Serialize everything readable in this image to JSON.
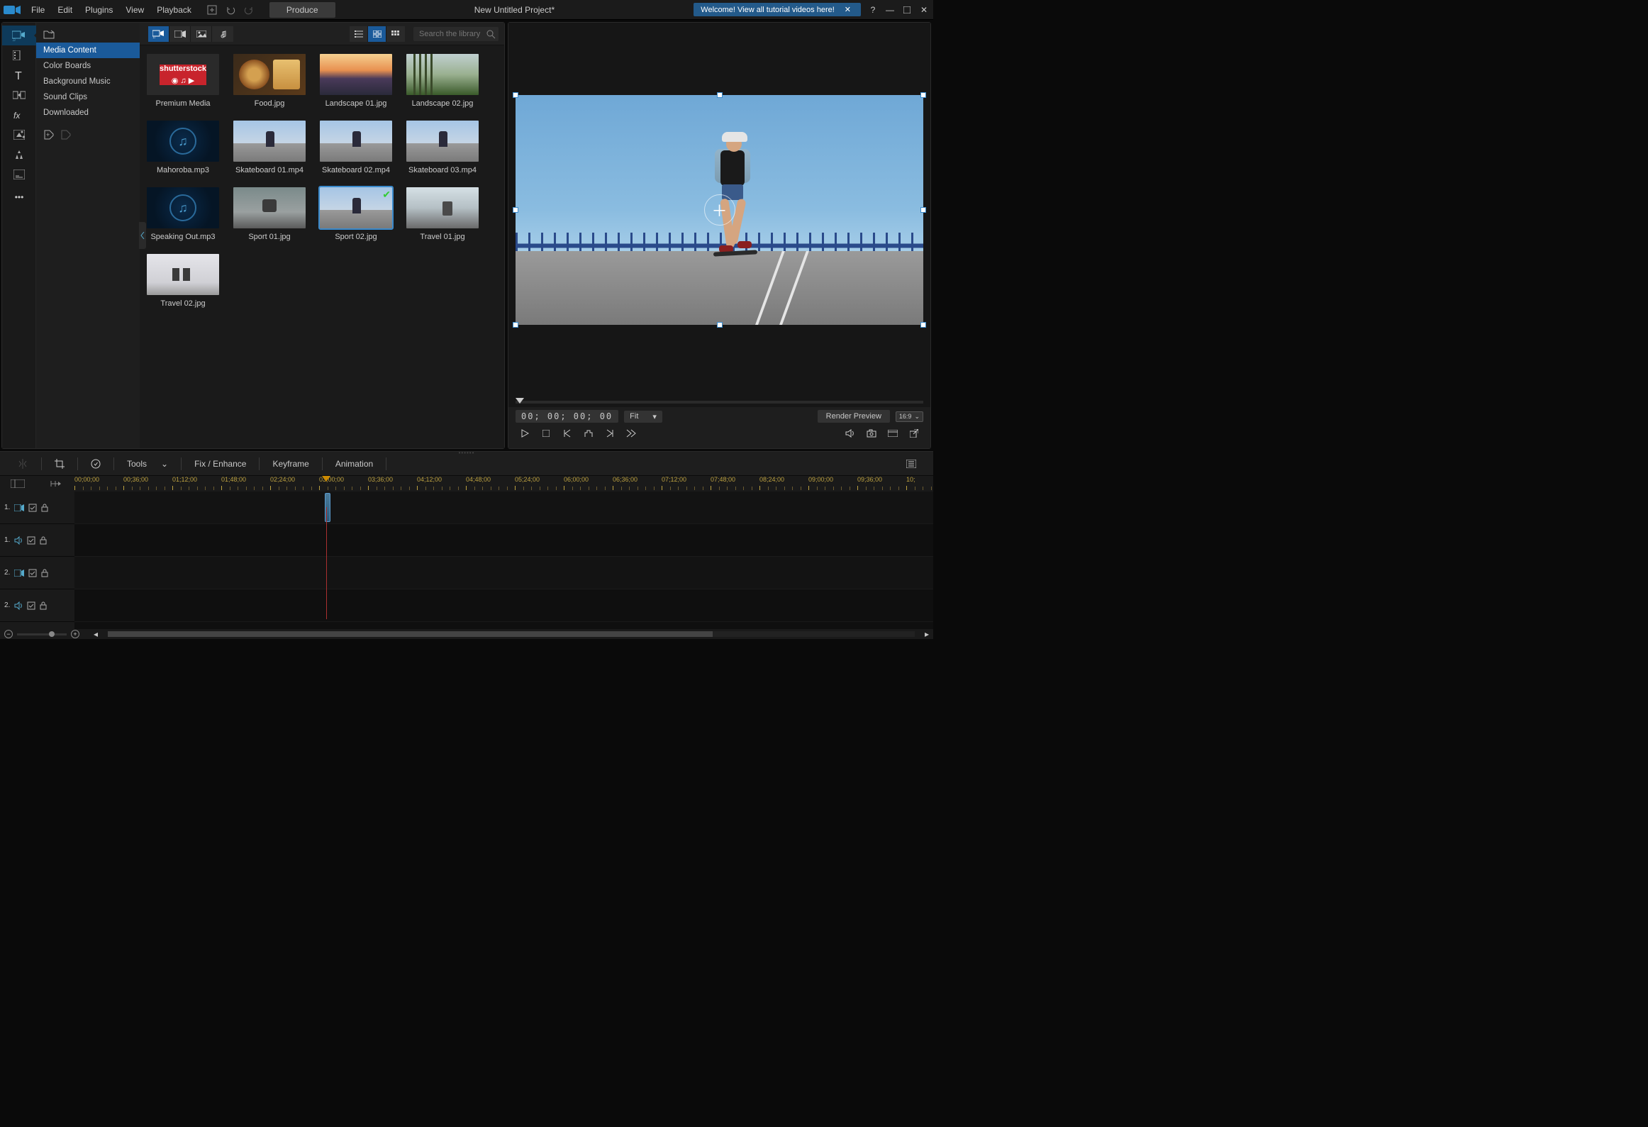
{
  "title_bar": {
    "menus": [
      "File",
      "Edit",
      "Plugins",
      "View",
      "Playback"
    ],
    "produce_label": "Produce",
    "project_title": "New Untitled Project*",
    "welcome_text": "Welcome! View all tutorial videos here!",
    "welcome_close": "✕"
  },
  "sidebar": {
    "items": [
      "Media Content",
      "Color Boards",
      "Background Music",
      "Sound Clips",
      "Downloaded"
    ],
    "selected_index": 0
  },
  "library": {
    "search_placeholder": "Search the library",
    "items": [
      {
        "label": "Premium Media",
        "kind": "shutterstock"
      },
      {
        "label": "Food.jpg",
        "kind": "food"
      },
      {
        "label": "Landscape 01.jpg",
        "kind": "land1"
      },
      {
        "label": "Landscape 02.jpg",
        "kind": "land2"
      },
      {
        "label": "Mahoroba.mp3",
        "kind": "audio"
      },
      {
        "label": "Skateboard 01.mp4",
        "kind": "skate"
      },
      {
        "label": "Skateboard 02.mp4",
        "kind": "skate"
      },
      {
        "label": "Skateboard 03.mp4",
        "kind": "skate"
      },
      {
        "label": "Speaking Out.mp3",
        "kind": "audio"
      },
      {
        "label": "Sport 01.jpg",
        "kind": "sport1"
      },
      {
        "label": "Sport 02.jpg",
        "kind": "skate",
        "selected": true,
        "checked": true
      },
      {
        "label": "Travel 01.jpg",
        "kind": "travel1"
      },
      {
        "label": "Travel 02.jpg",
        "kind": "travel2"
      }
    ]
  },
  "preview": {
    "timecode": "00; 00; 00; 00",
    "fit_label": "Fit",
    "render_label": "Render Preview",
    "aspect": "16:9"
  },
  "timeline": {
    "toolbar": {
      "tools": "Tools",
      "fix": "Fix / Enhance",
      "keyframe": "Keyframe",
      "animation": "Animation"
    },
    "ruler_ticks": [
      "00;00;00",
      "00;36;00",
      "01;12;00",
      "01;48;00",
      "02;24;00",
      "03;00;00",
      "03;36;00",
      "04;12;00",
      "04;48;00",
      "05;24;00",
      "06;00;00",
      "06;36;00",
      "07;12;00",
      "07;48;00",
      "08;24;00",
      "09;00;00",
      "09;36;00",
      "10;"
    ],
    "playhead_tick_index": 5,
    "tracks": [
      {
        "num": "1.",
        "type": "video"
      },
      {
        "num": "1.",
        "type": "audio"
      },
      {
        "num": "2.",
        "type": "video"
      },
      {
        "num": "2.",
        "type": "audio"
      }
    ]
  }
}
